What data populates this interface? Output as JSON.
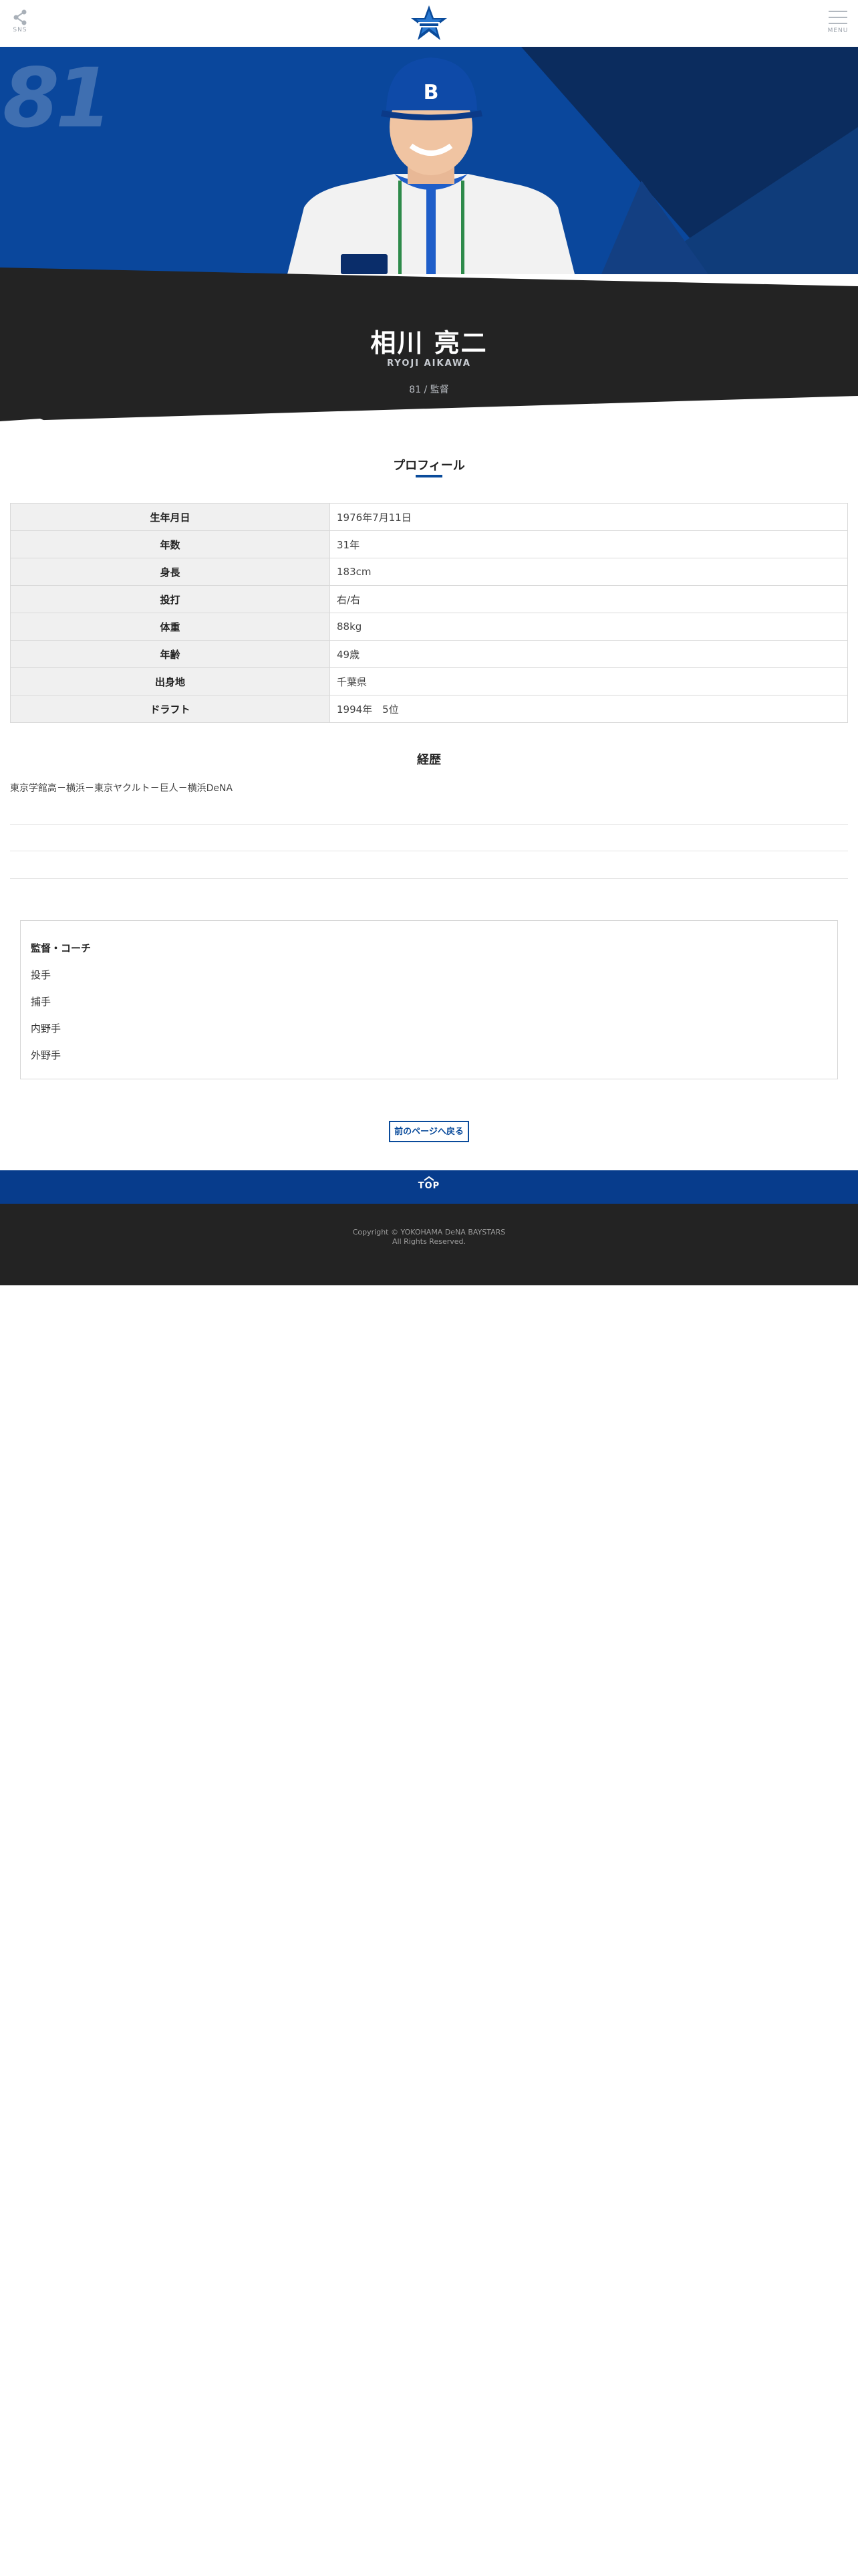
{
  "header": {
    "share_label": "SNS",
    "menu_label": "MENU"
  },
  "player": {
    "number": "81",
    "name_ja": "相川 亮二",
    "name_en": "RYOJI AIKAWA",
    "role": "81 / 監督"
  },
  "profile": {
    "title": "プロフィール",
    "rows": [
      {
        "label": "生年月日",
        "value": "1976年7月11日"
      },
      {
        "label": "年数",
        "value": "31年"
      },
      {
        "label": "身長",
        "value": "183cm"
      },
      {
        "label": "投打",
        "value": "右/右"
      },
      {
        "label": "体重",
        "value": "88kg"
      },
      {
        "label": "年齢",
        "value": "49歳"
      },
      {
        "label": "出身地",
        "value": "千葉県"
      },
      {
        "label": "ドラフト",
        "value": "1994年　5位"
      }
    ]
  },
  "career": {
    "title": "経歴",
    "text": "東京学館高－横浜－東京ヤクルト－巨人－横浜DeNA"
  },
  "categories": {
    "items": [
      "監督・コーチ",
      "投手",
      "捕手",
      "内野手",
      "外野手"
    ]
  },
  "back_button": "前のページへ戻る",
  "footer": {
    "top_label": "TOP",
    "copyright_line1": "Copyright © YOKOHAMA DeNA BAYSTARS",
    "copyright_line2": "All Rights Reserved."
  },
  "colors": {
    "brand_blue": "#073c8c",
    "dark": "#232323"
  }
}
